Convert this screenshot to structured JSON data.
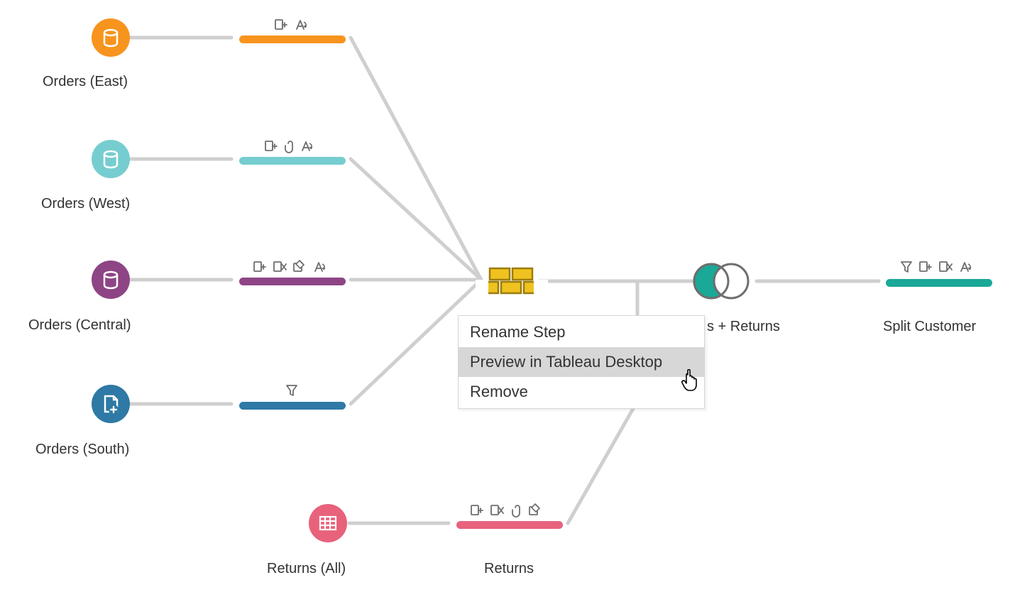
{
  "nodes": {
    "orders_east": {
      "label": "Orders (East)"
    },
    "orders_west": {
      "label": "Orders (West)"
    },
    "orders_central": {
      "label": "Orders (Central)"
    },
    "orders_south": {
      "label": "Orders (South)"
    },
    "returns_all": {
      "label": "Returns (All)"
    },
    "returns": {
      "label": "Returns"
    },
    "orders_returns": {
      "label": "s + Returns"
    },
    "split_customer": {
      "label": "Split Customer"
    }
  },
  "context_menu": {
    "rename": "Rename Step",
    "preview": "Preview in Tableau Desktop",
    "remove": "Remove"
  },
  "colors": {
    "orange": "#f7941d",
    "teal_light": "#76cdd0",
    "plum": "#8e4585",
    "blue": "#2e79a5",
    "pink": "#e8627c",
    "teal": "#1aa897",
    "brick_yellow": "#f0c21f",
    "brick_stroke": "#9b7d0e",
    "connector": "#cfcfcf",
    "icon_gray": "#6e6e6e"
  }
}
